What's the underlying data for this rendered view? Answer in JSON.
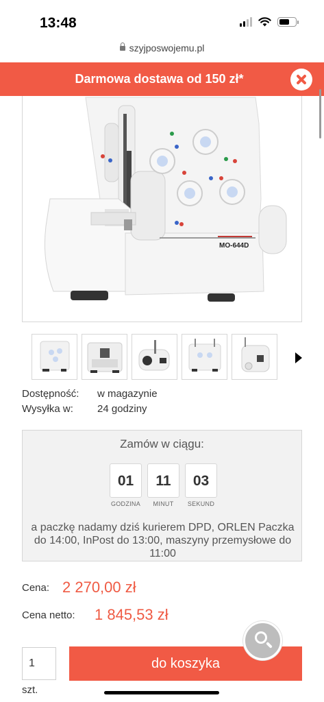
{
  "status_bar": {
    "time": "13:48"
  },
  "browser": {
    "url": "szyjposwojemu.pl"
  },
  "promo": {
    "text": "Darmowa dostawa od 150 zł*"
  },
  "product": {
    "model_label": "MO-644D",
    "thumbnail_count": 5
  },
  "availability": {
    "label": "Dostępność:",
    "value": "w magazynie"
  },
  "shipping": {
    "label": "Wysyłka w:",
    "value": "24 godziny"
  },
  "countdown": {
    "title": "Zamów w ciągu:",
    "units": [
      {
        "value": "01",
        "caption": "GODZINA"
      },
      {
        "value": "11",
        "caption": "MINUT"
      },
      {
        "value": "03",
        "caption": "SEKUND"
      }
    ],
    "note": "a paczkę nadamy dziś kurierem DPD, ORLEN Paczka do 14:00, InPost do 13:00, maszyny przemysłowe do 11:00"
  },
  "price": {
    "label": "Cena:",
    "value": "2 270,00 zł",
    "net_label": "Cena netto:",
    "net_value": "1 845,53 zł"
  },
  "cart": {
    "quantity": "1",
    "unit": "szt.",
    "button_label": "do koszyka"
  },
  "colors": {
    "accent": "#f15a45",
    "price": "#ef5a43"
  }
}
